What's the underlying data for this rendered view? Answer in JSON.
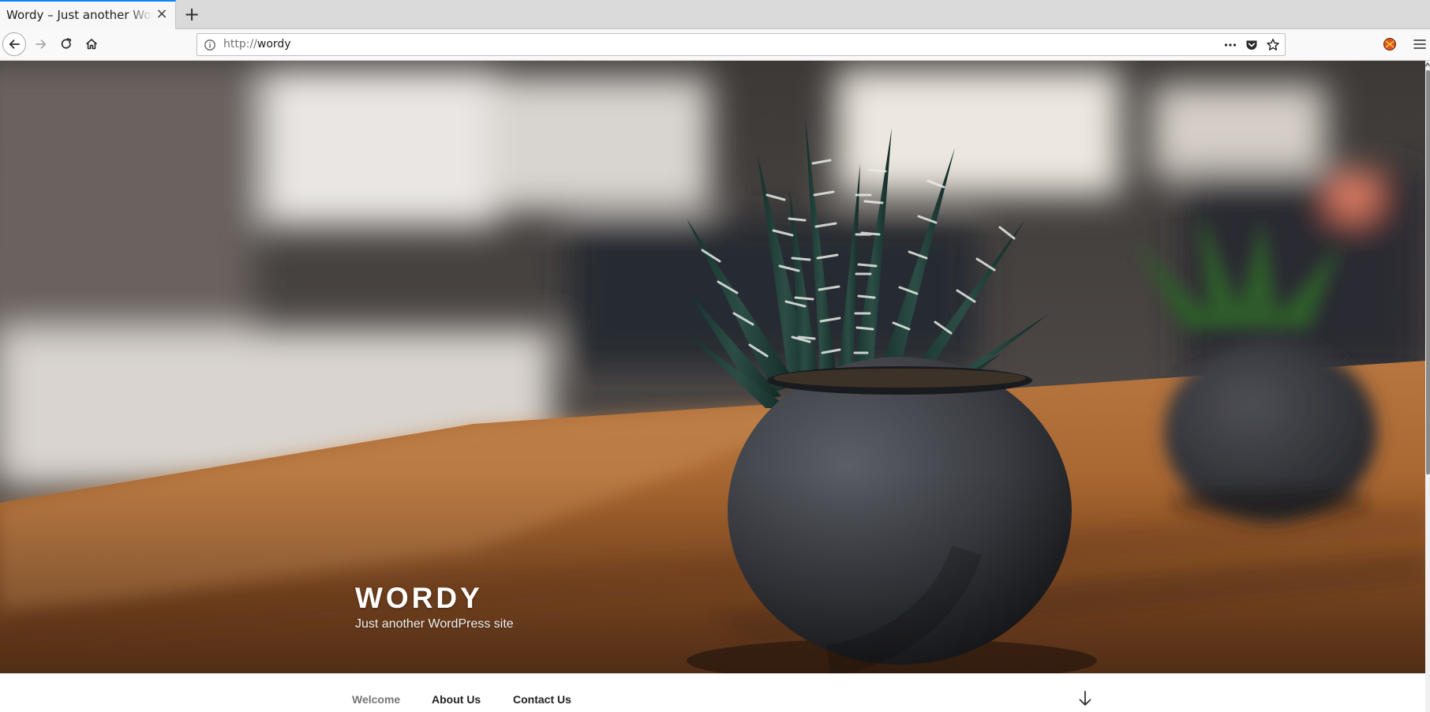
{
  "browser": {
    "tab": {
      "title": "Wordy – Just another WordPress site",
      "close_glyph": "×"
    },
    "new_tab_glyph": "+",
    "url": {
      "protocol": "http://",
      "host": "wordy"
    },
    "icons": {
      "back": "back-arrow-icon",
      "forward": "forward-arrow-icon",
      "reload": "reload-icon",
      "home": "home-icon",
      "info": "info-icon",
      "page_actions": "more-dots-icon",
      "pocket": "pocket-icon",
      "bookmark": "star-icon",
      "extension": "extension-icon",
      "menu": "hamburger-menu-icon"
    }
  },
  "site": {
    "title": "WORDY",
    "tagline": "Just another WordPress site"
  },
  "menu": {
    "items": [
      {
        "label": "Welcome",
        "current": true
      },
      {
        "label": "About Us",
        "current": false
      },
      {
        "label": "Contact Us",
        "current": false
      }
    ],
    "scroll_down_icon": "arrow-down-icon"
  },
  "colors": {
    "tab_accent": "#0a84ff",
    "menu_text": "#222222",
    "menu_current": "#767676",
    "title_text": "#ffffff"
  }
}
